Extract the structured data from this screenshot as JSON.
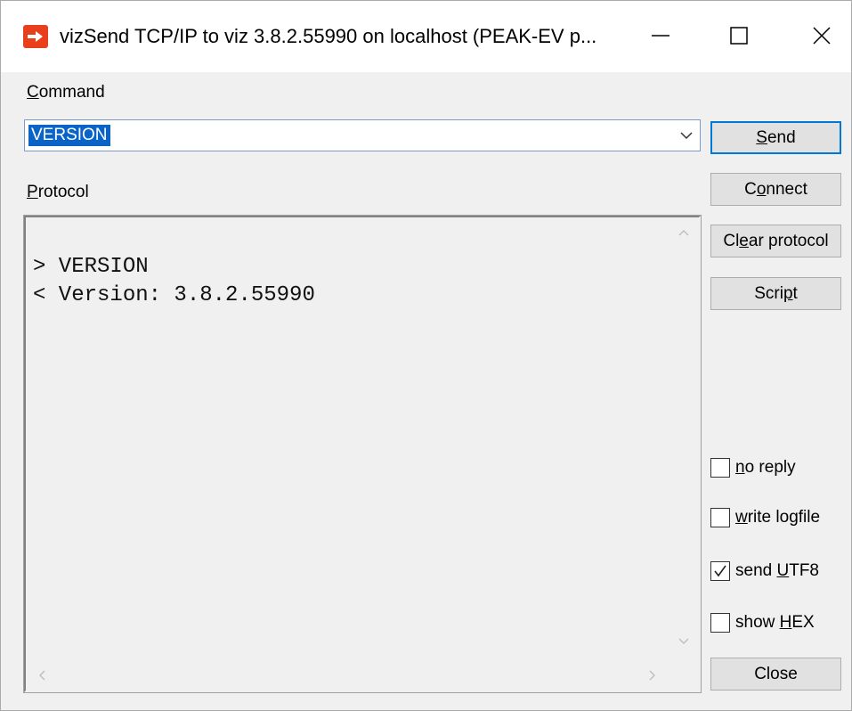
{
  "window": {
    "title": "vizSend TCP/IP to viz 3.8.2.55990 on localhost (PEAK-EV p...",
    "app_icon": "vizsend-arrow-icon"
  },
  "command": {
    "label_first": "C",
    "label_rest": "ommand",
    "value": "VERSION"
  },
  "protocol": {
    "label_first": "P",
    "label_rest": "rotocol",
    "lines": [
      "> VERSION",
      "< Version: 3.8.2.55990"
    ]
  },
  "buttons": {
    "send": {
      "pre": "",
      "u": "S",
      "post": "end"
    },
    "connect": {
      "pre": "C",
      "u": "o",
      "post": "nnect"
    },
    "clear": {
      "pre": "Cl",
      "u": "e",
      "post": "ar protocol"
    },
    "script": {
      "pre": "Scri",
      "u": "p",
      "post": "t"
    },
    "close": {
      "pre": "Close",
      "u": "",
      "post": ""
    }
  },
  "options": [
    {
      "pre": "",
      "u": "n",
      "post": "o reply",
      "checked": false
    },
    {
      "pre": "",
      "u": "w",
      "post": "rite logfile",
      "checked": false
    },
    {
      "pre": "send ",
      "u": "U",
      "post": "TF8",
      "checked": true
    },
    {
      "pre": "show ",
      "u": "H",
      "post": "EX",
      "checked": false
    }
  ],
  "colors": {
    "accent": "#0078d7",
    "icon": "#e8401c"
  }
}
